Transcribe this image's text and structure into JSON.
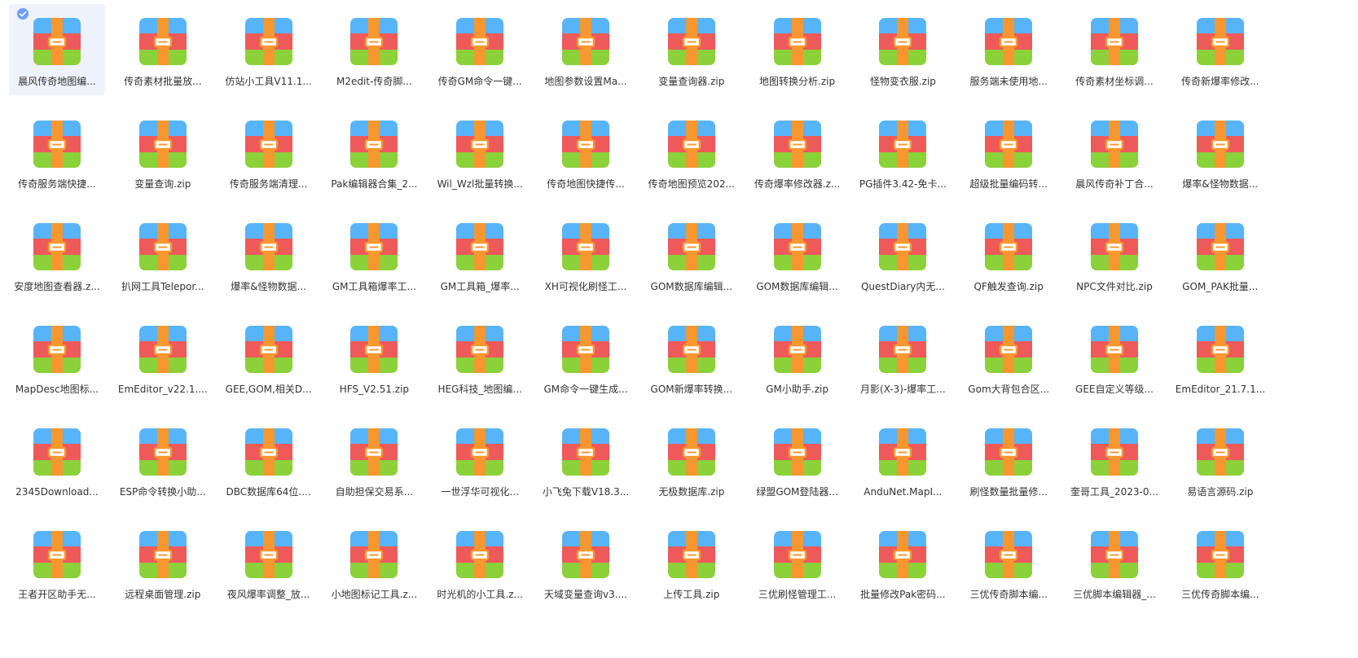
{
  "file_browser": {
    "view": "large-icons",
    "icon": "zip-archive-icon",
    "selected_index": 0,
    "colors": {
      "icon_top": "#58b4f8",
      "icon_middle": "#ee5a5a",
      "icon_bottom": "#8bd13a",
      "icon_strap": "#f7972f",
      "selection_bg": "#eef2fb",
      "check_badge": "#6e9fff"
    },
    "files": [
      "晨风传奇地图编...",
      "传奇素材批量放...",
      "仿站小工具V11.1...",
      "M2edit-传奇脚...",
      "传奇GM命令一键...",
      "地图参数设置Ma...",
      "变量查询器.zip",
      "地图转换分析.zip",
      "怪物变衣服.zip",
      "服务端未使用地...",
      "传奇素材坐标调...",
      "传奇新爆率修改...",
      "传奇服务端快捷...",
      "变量查询.zip",
      "传奇服务端清理...",
      "Pak编辑器合集_2...",
      "Wil_Wzl批量转换...",
      "传奇地图快捷传...",
      "传奇地图预览202...",
      "传奇爆率修改器.z...",
      "PG插件3.42-免卡...",
      "超级批量编码转...",
      "晨风传奇补丁合...",
      "爆率&怪物数据...",
      "安度地图查看器.z...",
      "扒网工具Telepor...",
      "爆率&怪物数据...",
      "GM工具箱爆率工...",
      "GM工具箱_爆率...",
      "XH可视化刷怪工...",
      "GOM数据库编辑...",
      "GOM数据库编辑...",
      "QuestDiary内无...",
      "QF触发查询.zip",
      "NPC文件对比.zip",
      "GOM_PAK批量...",
      "MapDesc地图标...",
      "EmEditor_v22.1....",
      "GEE,GOM,相关D...",
      "HFS_V2.51.zip",
      "HEG科技_地图编...",
      "GM命令一键生成...",
      "GOM新爆率转换...",
      "GM小助手.zip",
      "月影(X-3)-爆率工...",
      "Gom大背包合区...",
      "GEE自定义等级...",
      "EmEditor_21.7.1...",
      "2345Download...",
      "ESP命令转换小助...",
      "DBC数据库64位....",
      "自助担保交易系...",
      "一世浮华可视化...",
      "小飞兔下载V18.3...",
      "无极数据库.zip",
      "绿盟GOM登陆器...",
      "AnduNet.MapI...",
      "刷怪数量批量修...",
      "奎哥工具_2023-0...",
      "易语言源码.zip",
      "王者开区助手无...",
      "远程桌面管理.zip",
      "夜风爆率调整_放...",
      "小地图标记工具.z...",
      "时光机的小工具.z...",
      "天域变量查询v3....",
      "上传工具.zip",
      "三优刷怪管理工...",
      "批量修改Pak密码...",
      "三优传奇脚本编...",
      "三优脚本编辑器_...",
      "三优传奇脚本编..."
    ]
  }
}
